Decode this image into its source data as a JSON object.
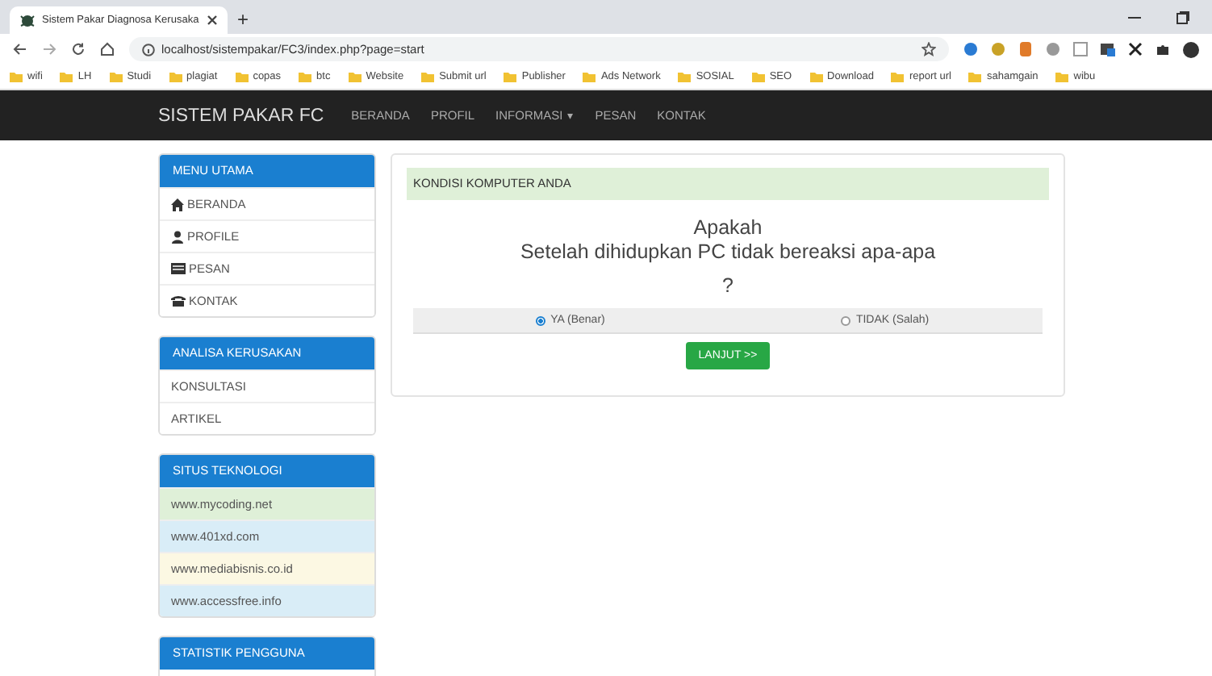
{
  "browser": {
    "tab_title": "Sistem Pakar Diagnosa Kerusaka",
    "new_tab": "+",
    "address": "localhost/sistempakar/FC3/index.php?page=start",
    "bookmarks": [
      "wifi",
      "LH",
      "Studi",
      "plagiat",
      "copas",
      "btc",
      "Website",
      "Submit url",
      "Publisher",
      "Ads Network",
      "SOSIAL",
      "SEO",
      "Download",
      "report url",
      "sahamgain",
      "wibu"
    ]
  },
  "navbar": {
    "brand": "SISTEM PAKAR FC",
    "items": [
      {
        "label": "BERANDA"
      },
      {
        "label": "PROFIL"
      },
      {
        "label": "INFORMASI",
        "caret": "▾"
      },
      {
        "label": "PESAN"
      },
      {
        "label": "KONTAK"
      }
    ]
  },
  "sidebar": [
    {
      "title": "MENU UTAMA",
      "items": [
        {
          "label": "BERANDA",
          "kind": "home"
        },
        {
          "label": "PROFILE",
          "kind": "user"
        },
        {
          "label": "PESAN",
          "kind": "message"
        },
        {
          "label": "KONTAK",
          "kind": "phone"
        }
      ]
    },
    {
      "title": "ANALISA KERUSAKAN",
      "items": [
        {
          "label": "KONSULTASI"
        },
        {
          "label": "ARTIKEL"
        }
      ]
    },
    {
      "title": "SITUS TEKNOLOGI",
      "items": [
        {
          "label": "www.mycoding.net",
          "color": "#dff0d8"
        },
        {
          "label": "www.401xd.com",
          "color": "#d9edf7"
        },
        {
          "label": "www.mediabisnis.co.id",
          "color": "#fcf8e3"
        },
        {
          "label": "www.accessfree.info",
          "color": "#d9edf7"
        }
      ]
    },
    {
      "title": "STATISTIK PENGGUNA"
    }
  ],
  "main": {
    "heading": "KONDISI KOMPUTER ANDA",
    "question_lines": [
      "Apakah",
      "Setelah dihidupkan PC tidak bereaksi apa-apa",
      "?"
    ],
    "options": [
      {
        "label": "YA (Benar)",
        "selected": true
      },
      {
        "label": "TIDAK (Salah)",
        "selected": false
      }
    ],
    "button": "LANJUT >>"
  }
}
